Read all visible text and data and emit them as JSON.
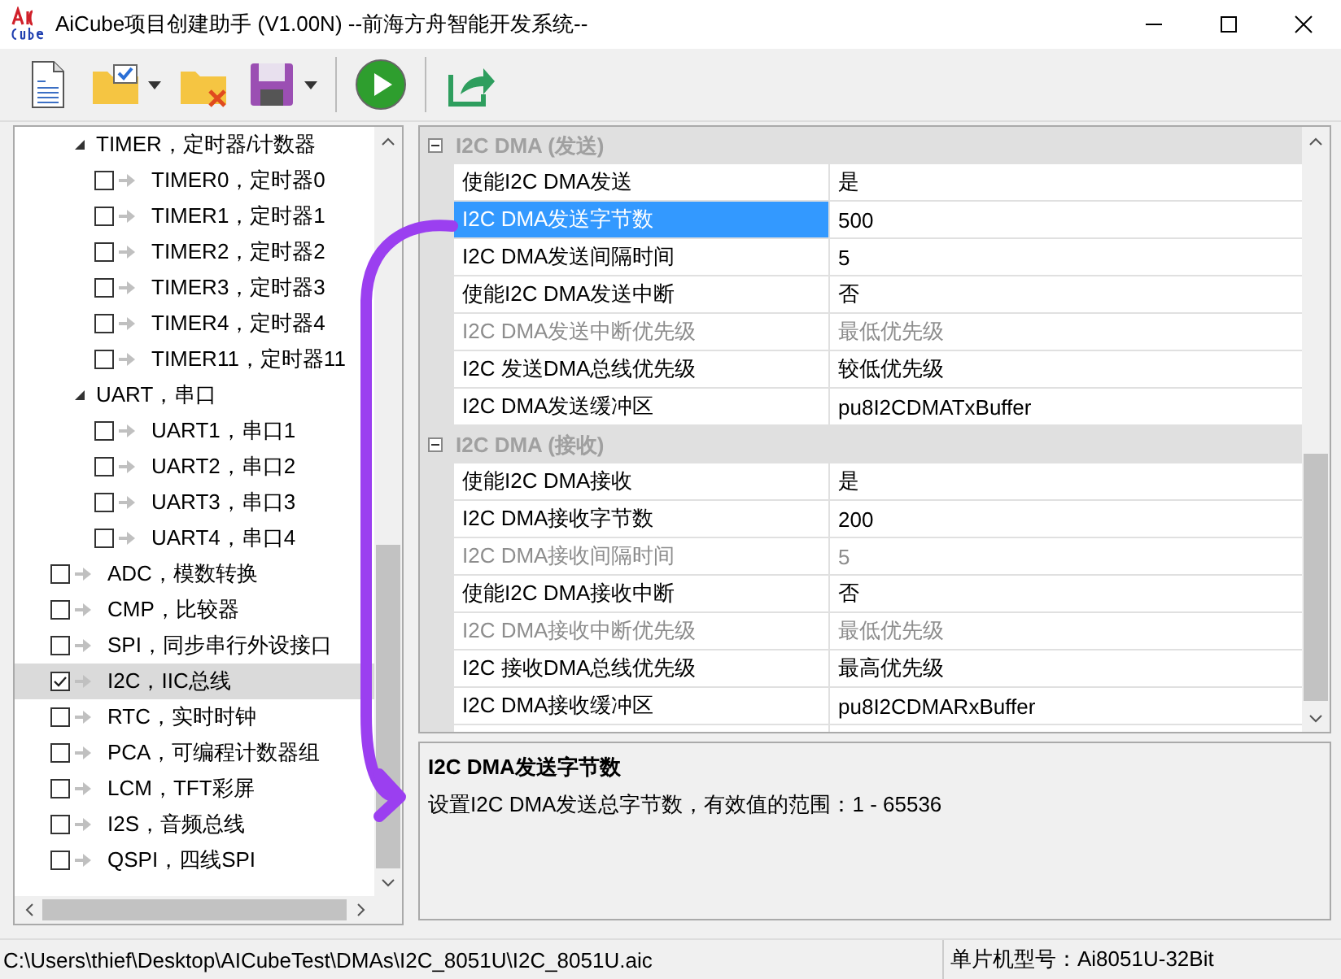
{
  "window": {
    "title": "AiCube项目创建助手 (V1.00N) --前海方舟智能开发系统--"
  },
  "toolbar": [
    {
      "kind": "document",
      "dropdown": false
    },
    {
      "kind": "folder-check",
      "dropdown": true
    },
    {
      "kind": "folder-delete",
      "dropdown": false
    },
    {
      "kind": "save",
      "dropdown": true
    },
    {
      "kind": "run",
      "dropdown": false
    },
    {
      "kind": "export",
      "dropdown": false
    }
  ],
  "tree": {
    "items": [
      {
        "label": "TIMER，定时器/计数器",
        "expanded": true,
        "children": [
          {
            "label": "TIMER0，定时器0",
            "checked": false,
            "selected": false
          },
          {
            "label": "TIMER1，定时器1",
            "checked": false,
            "selected": false
          },
          {
            "label": "TIMER2，定时器2",
            "checked": false,
            "selected": false
          },
          {
            "label": "TIMER3，定时器3",
            "checked": false,
            "selected": false
          },
          {
            "label": "TIMER4，定时器4",
            "checked": false,
            "selected": false
          },
          {
            "label": "TIMER11，定时器11",
            "checked": false,
            "selected": false
          }
        ]
      },
      {
        "label": "UART，串口",
        "expanded": true,
        "children": [
          {
            "label": "UART1，串口1",
            "checked": false,
            "selected": false
          },
          {
            "label": "UART2，串口2",
            "checked": false,
            "selected": false
          },
          {
            "label": "UART3，串口3",
            "checked": false,
            "selected": false
          },
          {
            "label": "UART4，串口4",
            "checked": false,
            "selected": false
          }
        ]
      }
    ],
    "top_items": [
      {
        "label": "ADC，模数转换",
        "checked": false,
        "selected": false
      },
      {
        "label": "CMP，比较器",
        "checked": false,
        "selected": false
      },
      {
        "label": "SPI，同步串行外设接口",
        "checked": false,
        "selected": false
      },
      {
        "label": "I2C，IIC总线",
        "checked": true,
        "selected": true
      },
      {
        "label": "RTC，实时时钟",
        "checked": false,
        "selected": false
      },
      {
        "label": "PCA，可编程计数器组",
        "checked": false,
        "selected": false
      },
      {
        "label": "LCM，TFT彩屏",
        "checked": false,
        "selected": false
      },
      {
        "label": "I2S，音频总线",
        "checked": false,
        "selected": false
      },
      {
        "label": "QSPI，四线SPI",
        "checked": false,
        "selected": false
      }
    ]
  },
  "properties": {
    "categories": [
      {
        "title": "I2C DMA (发送)",
        "expanded": true,
        "rows": [
          {
            "name": "使能I2C DMA发送",
            "value": "是",
            "disabled": false,
            "selected": false
          },
          {
            "name": "I2C DMA发送字节数",
            "value": "500",
            "disabled": false,
            "selected": true
          },
          {
            "name": "I2C DMA发送间隔时间",
            "value": "5",
            "disabled": false,
            "selected": false
          },
          {
            "name": "使能I2C DMA发送中断",
            "value": "否",
            "disabled": false,
            "selected": false
          },
          {
            "name": "I2C DMA发送中断优先级",
            "value": "最低优先级",
            "disabled": true,
            "selected": false
          },
          {
            "name": "I2C 发送DMA总线优先级",
            "value": "较低优先级",
            "disabled": false,
            "selected": false
          },
          {
            "name": "I2C DMA发送缓冲区",
            "value": "pu8I2CDMATxBuffer",
            "disabled": false,
            "selected": false
          }
        ]
      },
      {
        "title": "I2C DMA (接收)",
        "expanded": true,
        "rows": [
          {
            "name": "使能I2C DMA接收",
            "value": "是",
            "disabled": false,
            "selected": false
          },
          {
            "name": "I2C DMA接收字节数",
            "value": "200",
            "disabled": false,
            "selected": false
          },
          {
            "name": "I2C DMA接收间隔时间",
            "value": "5",
            "disabled": true,
            "selected": false
          },
          {
            "name": "使能I2C DMA接收中断",
            "value": "否",
            "disabled": false,
            "selected": false
          },
          {
            "name": "I2C DMA接收中断优先级",
            "value": "最低优先级",
            "disabled": true,
            "selected": false
          },
          {
            "name": "I2C 接收DMA总线优先级",
            "value": "最高优先级",
            "disabled": false,
            "selected": false
          },
          {
            "name": "I2C DMA接收缓冲区",
            "value": "pu8I2CDMARxBuffer",
            "disabled": false,
            "selected": false
          }
        ]
      }
    ]
  },
  "description": {
    "title": "I2C DMA发送字节数",
    "text": "设置I2C DMA发送总字节数，有效值的范围：1 - 65536"
  },
  "status_bar": {
    "path": "C:\\Users\\thief\\Desktop\\AICubeTest\\DMAs\\I2C_8051U\\I2C_8051U.aic",
    "chip": "单片机型号：Ai8051U-32Bit"
  }
}
